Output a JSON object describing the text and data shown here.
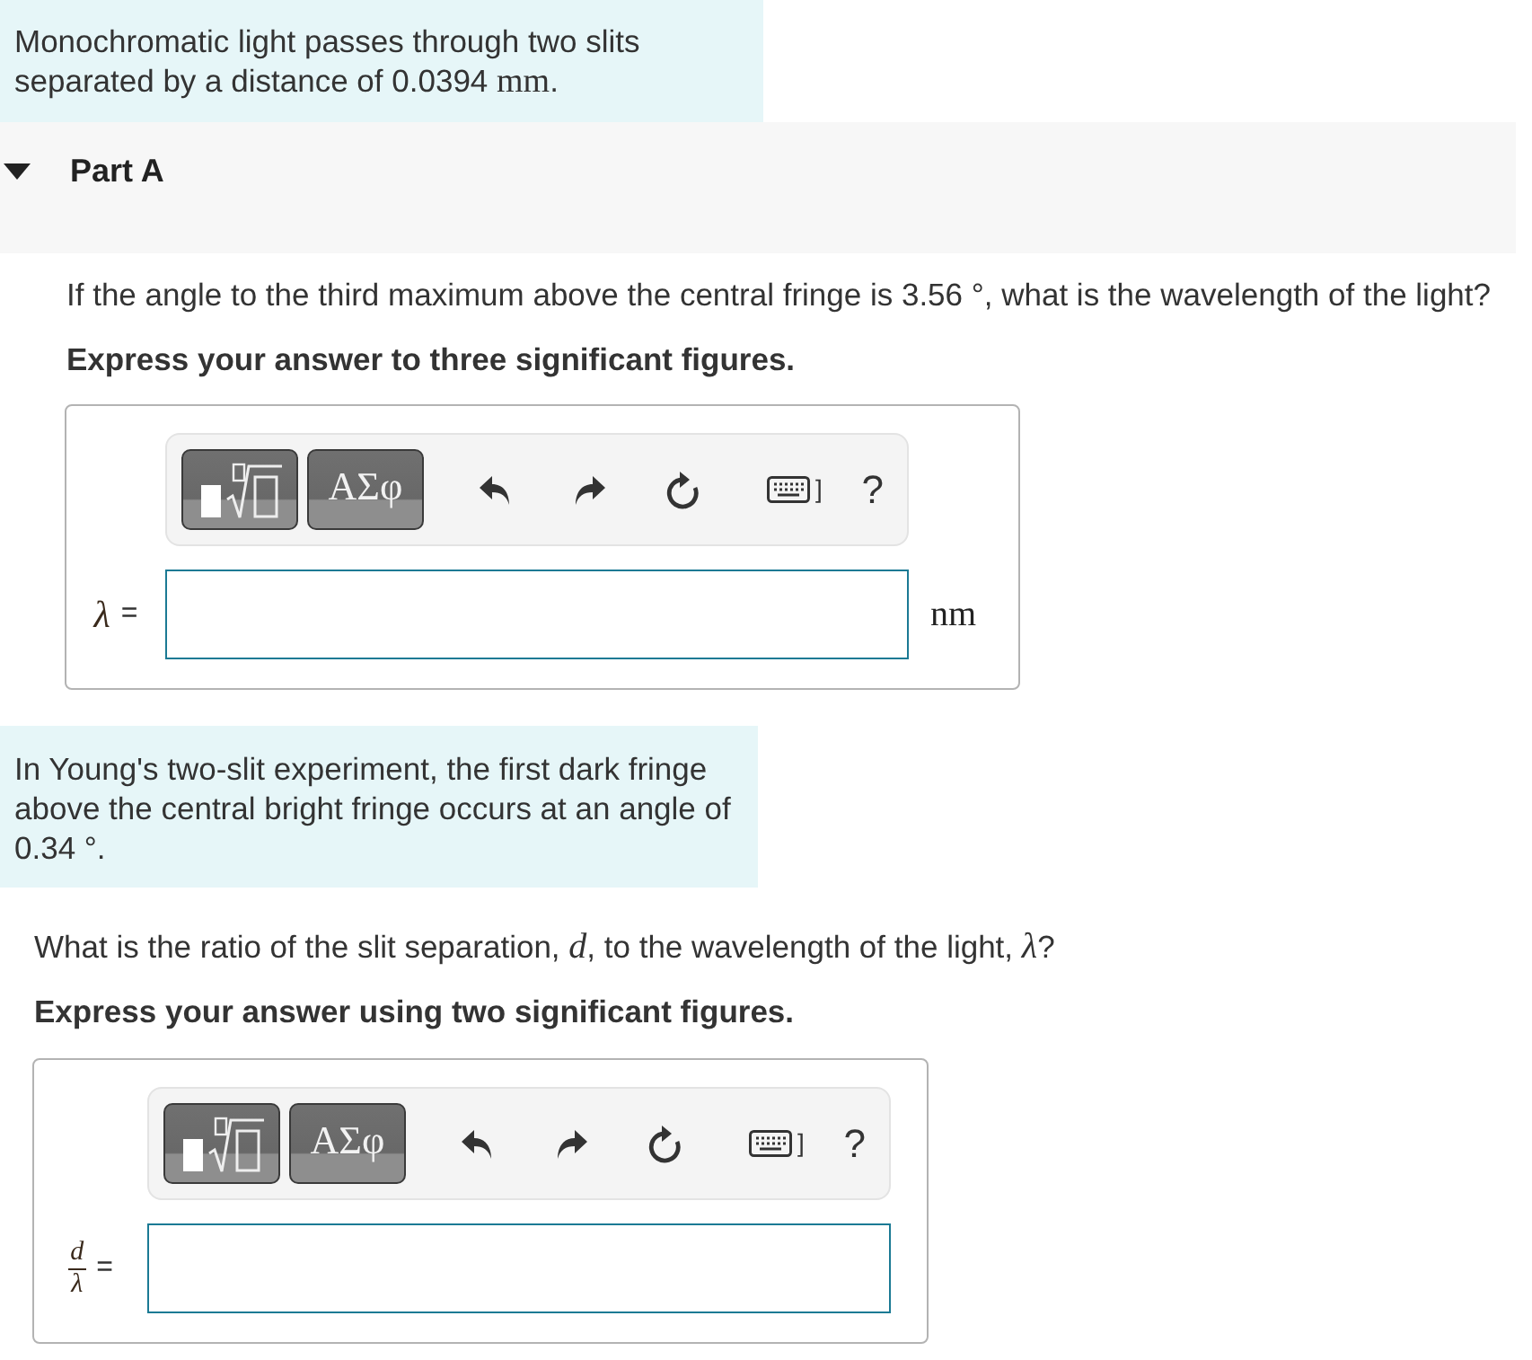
{
  "problems": [
    {
      "intro": [
        {
          "kind": "text",
          "text": "Monochromatic light passes through two slits separated by a distance of 0.0394 "
        },
        {
          "kind": "unit",
          "text": "mm"
        },
        {
          "kind": "text",
          "text": "."
        }
      ],
      "part": {
        "label": "Part A",
        "expanded": true
      },
      "question": [
        {
          "kind": "text",
          "text": "If the angle to the third maximum above the central fringe is 3.56 °, what is the wavelength of the light?"
        }
      ],
      "instruction": "Express your answer to three significant figures.",
      "answer": {
        "toolbar": {
          "greek": "ΑΣφ",
          "keyboard_caret": "]",
          "help": "?"
        },
        "lhs": {
          "kind": "symbol",
          "text": "λ"
        },
        "equals": "=",
        "unit": "nm"
      }
    },
    {
      "intro": [
        {
          "kind": "text",
          "text": "In Young's two-slit experiment, the first dark fringe above the central bright fringe occurs at an angle of 0.34 °."
        }
      ],
      "question": [
        {
          "kind": "text",
          "text": "What is the ratio of the slit separation, "
        },
        {
          "kind": "variable",
          "text": "d"
        },
        {
          "kind": "text",
          "text": ", to the wavelength of the light, "
        },
        {
          "kind": "variable",
          "text": "λ"
        },
        {
          "kind": "text",
          "text": "?"
        }
      ],
      "instruction": "Express your answer using two significant figures.",
      "answer": {
        "toolbar": {
          "greek": "ΑΣφ",
          "keyboard_caret": "]",
          "help": "?"
        },
        "lhs": {
          "kind": "fraction",
          "numerator": "d",
          "denominator": "λ"
        },
        "equals": "="
      }
    }
  ]
}
